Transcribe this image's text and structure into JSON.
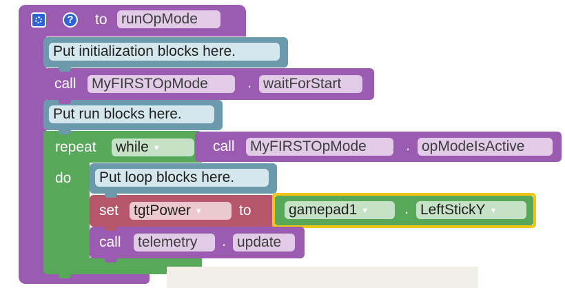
{
  "function_block": {
    "to_label": "to",
    "name": "runOpMode",
    "icons": [
      "gear-icon",
      "help-icon"
    ]
  },
  "comment_init": "Put initialization blocks here.",
  "call_wait": {
    "call_label": "call",
    "object": "MyFIRSTOpMode",
    "dot": ".",
    "method": "waitForStart"
  },
  "comment_run": "Put run blocks here.",
  "repeat_block": {
    "repeat_label": "repeat",
    "mode": "while",
    "do_label": "do",
    "condition": {
      "call_label": "call",
      "object": "MyFIRSTOpMode",
      "dot": ".",
      "method": "opModeIsActive"
    }
  },
  "comment_loop": "Put loop blocks here.",
  "set_block": {
    "set_label": "set",
    "variable": "tgtPower",
    "to_label": "to",
    "gamepad": "gamepad1",
    "dot": ".",
    "property": "LeftStickY"
  },
  "call_telemetry": {
    "call_label": "call",
    "object": "telemetry",
    "dot": ".",
    "method": "update"
  },
  "colors": {
    "procedure": "#9b5bb0",
    "comment": "#6a9aab",
    "loop": "#58a85a",
    "variable": "#b5566a",
    "selection": "#f2c318"
  }
}
